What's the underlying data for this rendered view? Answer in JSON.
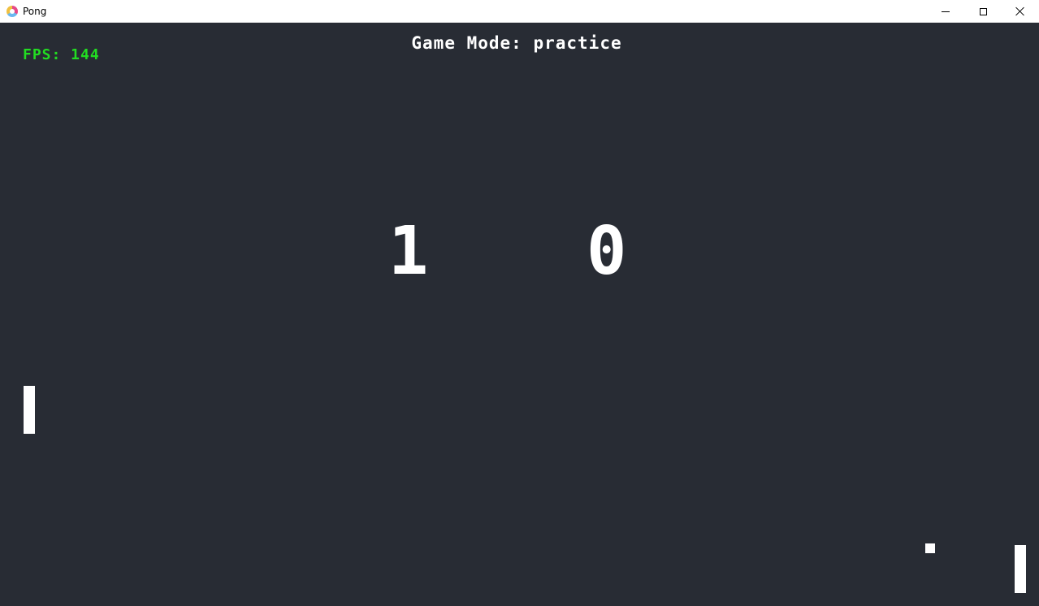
{
  "window": {
    "title": "Pong",
    "app_icon": "pong-app-icon"
  },
  "controls": {
    "minimize_icon": "minimize-icon",
    "maximize_icon": "maximize-icon",
    "close_icon": "close-icon"
  },
  "game": {
    "fps_text": "FPS: 144",
    "mode_text": "Game Mode: practice",
    "score_left": "1",
    "score_right": "0"
  },
  "colors": {
    "background": "#282c34",
    "fps": "#22dd22",
    "foreground": "#ffffff"
  }
}
